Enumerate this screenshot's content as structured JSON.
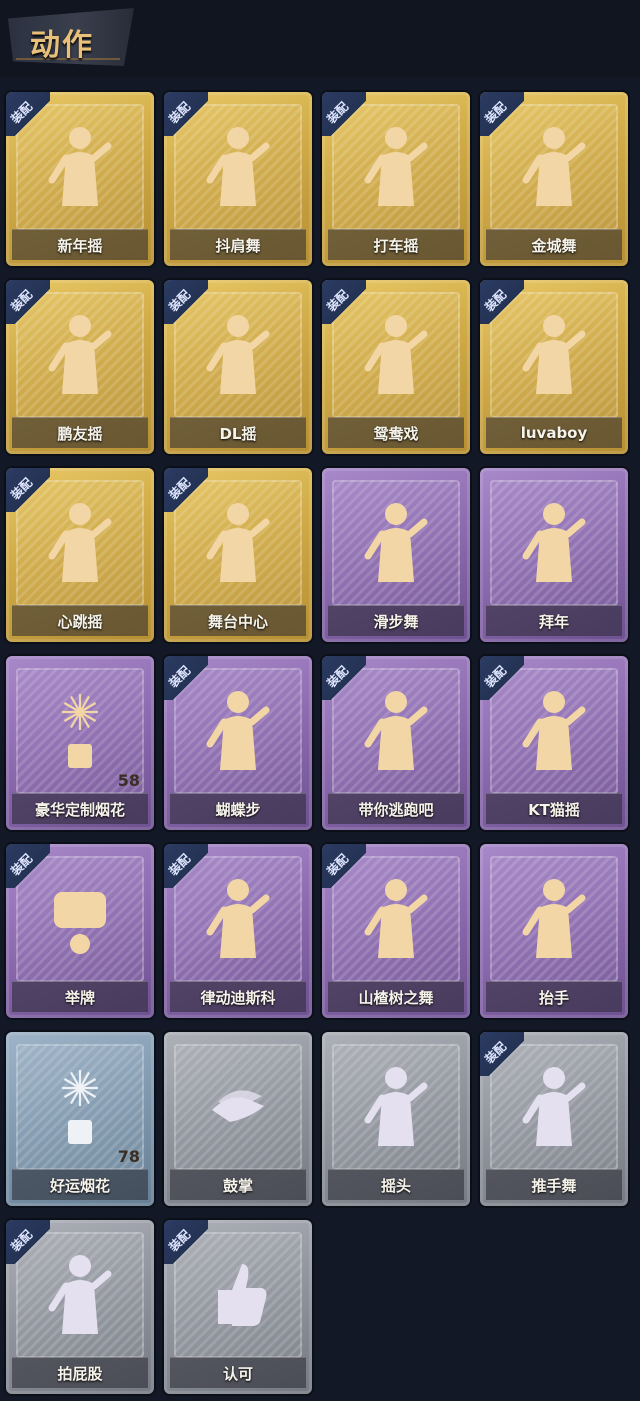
{
  "section": {
    "title": "动作"
  },
  "badge_text": "装配",
  "cards": [
    {
      "label": "新年摇",
      "tier": "gold",
      "equipped": true,
      "icon": "dance-pose-icon"
    },
    {
      "label": "抖肩舞",
      "tier": "gold",
      "equipped": true,
      "icon": "dance-pose-icon"
    },
    {
      "label": "打车摇",
      "tier": "gold",
      "equipped": true,
      "icon": "dance-pose-icon"
    },
    {
      "label": "金城舞",
      "tier": "gold",
      "equipped": true,
      "icon": "dance-pose-icon"
    },
    {
      "label": "鹏友摇",
      "tier": "gold",
      "equipped": true,
      "icon": "dance-pose-icon"
    },
    {
      "label": "DL摇",
      "tier": "gold",
      "equipped": true,
      "icon": "dance-pose-icon"
    },
    {
      "label": "鸳鸯戏",
      "tier": "gold",
      "equipped": true,
      "icon": "dance-pose-icon"
    },
    {
      "label": "luvaboy",
      "tier": "gold",
      "equipped": true,
      "icon": "dance-pose-icon"
    },
    {
      "label": "心跳摇",
      "tier": "gold",
      "equipped": true,
      "icon": "dance-pose-icon"
    },
    {
      "label": "舞台中心",
      "tier": "gold",
      "equipped": true,
      "icon": "dance-pose-icon"
    },
    {
      "label": "滑步舞",
      "tier": "purple",
      "equipped": false,
      "icon": "dance-pose-icon"
    },
    {
      "label": "拜年",
      "tier": "purple",
      "equipped": false,
      "icon": "dance-pose-icon"
    },
    {
      "label": "豪华定制烟花",
      "tier": "purple",
      "equipped": false,
      "icon": "fireworks-icon",
      "count": "58"
    },
    {
      "label": "蝴蝶步",
      "tier": "purple",
      "equipped": true,
      "icon": "dance-pose-icon"
    },
    {
      "label": "带你逃跑吧",
      "tier": "purple",
      "equipped": true,
      "icon": "dance-pose-icon"
    },
    {
      "label": "KT猫摇",
      "tier": "purple",
      "equipped": true,
      "icon": "dance-pose-icon"
    },
    {
      "label": "举牌",
      "tier": "purple",
      "equipped": true,
      "icon": "sign-icon"
    },
    {
      "label": "律动迪斯科",
      "tier": "purple",
      "equipped": true,
      "icon": "dance-pose-icon"
    },
    {
      "label": "山楂树之舞",
      "tier": "purple",
      "equipped": true,
      "icon": "dance-pose-icon"
    },
    {
      "label": "抬手",
      "tier": "purple",
      "equipped": false,
      "icon": "dance-pose-icon"
    },
    {
      "label": "好运烟花",
      "tier": "blue",
      "equipped": false,
      "icon": "fireworks-icon",
      "count": "78"
    },
    {
      "label": "鼓掌",
      "tier": "gray",
      "equipped": false,
      "icon": "clap-icon"
    },
    {
      "label": "摇头",
      "tier": "gray",
      "equipped": false,
      "icon": "dance-pose-icon"
    },
    {
      "label": "推手舞",
      "tier": "gray",
      "equipped": true,
      "icon": "dance-pose-icon"
    },
    {
      "label": "拍屁股",
      "tier": "gray",
      "equipped": true,
      "icon": "dance-pose-icon"
    },
    {
      "label": "认可",
      "tier": "gray",
      "equipped": true,
      "icon": "thumbs-up-icon"
    }
  ]
}
